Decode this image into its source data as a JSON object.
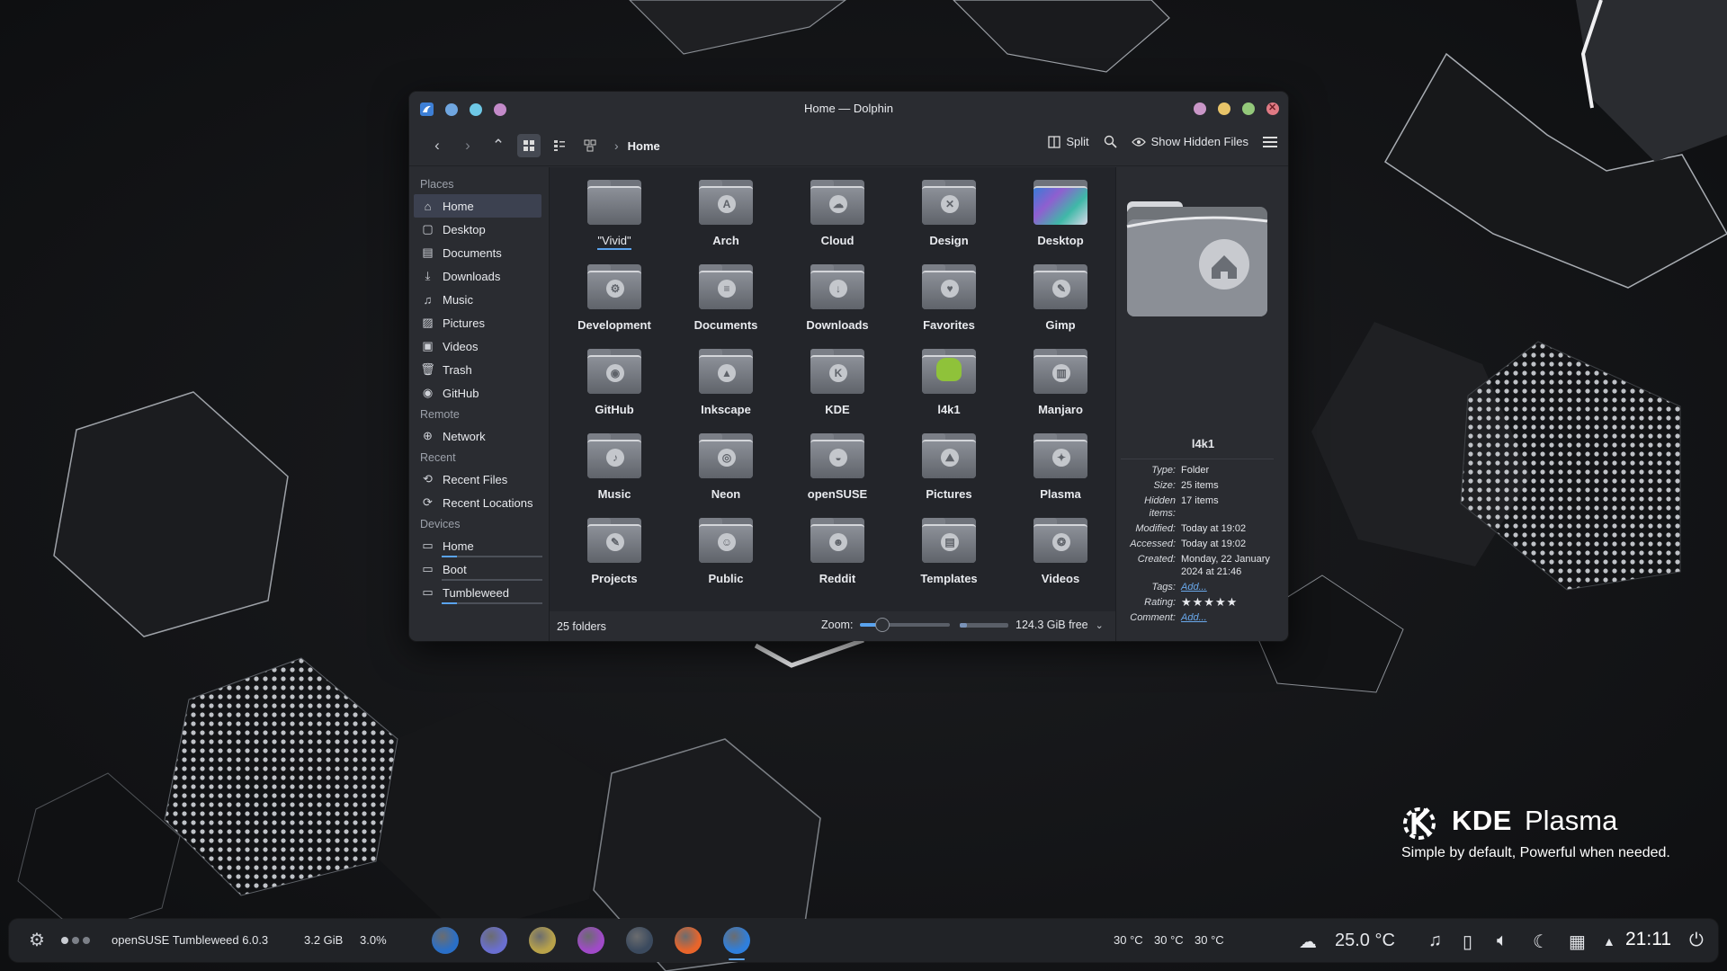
{
  "desktop": {
    "brand_kde": "KDE",
    "brand_plasma": "Plasma",
    "brand_tagline": "Simple by default, Powerful when  needed."
  },
  "window": {
    "title": "Home — Dolphin",
    "breadcrumb": "Home",
    "toolbar": {
      "split_label": "Split",
      "hidden_files_label": "Show Hidden Files"
    }
  },
  "sidebar": {
    "places_label": "Places",
    "places": [
      {
        "label": "Home",
        "icon": "home-icon",
        "selected": true
      },
      {
        "label": "Desktop",
        "icon": "desktop-icon"
      },
      {
        "label": "Documents",
        "icon": "documents-icon"
      },
      {
        "label": "Downloads",
        "icon": "downloads-icon"
      },
      {
        "label": "Music",
        "icon": "music-icon"
      },
      {
        "label": "Pictures",
        "icon": "pictures-icon"
      },
      {
        "label": "Videos",
        "icon": "videos-icon"
      },
      {
        "label": "Trash",
        "icon": "trash-icon"
      },
      {
        "label": "GitHub",
        "icon": "github-icon"
      }
    ],
    "remote_label": "Remote",
    "remote": [
      {
        "label": "Network",
        "icon": "network-icon"
      }
    ],
    "recent_label": "Recent",
    "recent": [
      {
        "label": "Recent Files",
        "icon": "recent-files-icon"
      },
      {
        "label": "Recent Locations",
        "icon": "recent-locations-icon"
      }
    ],
    "devices_label": "Devices",
    "devices": [
      {
        "label": "Home",
        "icon": "drive-icon",
        "usage": 0.15
      },
      {
        "label": "Boot",
        "icon": "drive-icon",
        "usage": 0.0
      },
      {
        "label": "Tumbleweed",
        "icon": "drive-icon",
        "usage": 0.15
      }
    ]
  },
  "folders": [
    {
      "name": "\"Vivid\"",
      "emblem": ""
    },
    {
      "name": "Arch",
      "emblem": "A"
    },
    {
      "name": "Cloud",
      "emblem": "☁"
    },
    {
      "name": "Design",
      "emblem": "✕"
    },
    {
      "name": "Desktop",
      "emblem": ""
    },
    {
      "name": "Development",
      "emblem": "⚙"
    },
    {
      "name": "Documents",
      "emblem": "≡"
    },
    {
      "name": "Downloads",
      "emblem": "↓"
    },
    {
      "name": "Favorites",
      "emblem": "♥"
    },
    {
      "name": "Gimp",
      "emblem": "✎"
    },
    {
      "name": "GitHub",
      "emblem": "◉"
    },
    {
      "name": "Inkscape",
      "emblem": "▲"
    },
    {
      "name": "KDE",
      "emblem": "K"
    },
    {
      "name": "l4k1",
      "emblem": ""
    },
    {
      "name": "Manjaro",
      "emblem": "▥"
    },
    {
      "name": "Music",
      "emblem": "♪"
    },
    {
      "name": "Neon",
      "emblem": "◎"
    },
    {
      "name": "openSUSE",
      "emblem": "◒"
    },
    {
      "name": "Pictures",
      "emblem": "⛰"
    },
    {
      "name": "Plasma",
      "emblem": "✦"
    },
    {
      "name": "Projects",
      "emblem": "✎"
    },
    {
      "name": "Public",
      "emblem": "☺"
    },
    {
      "name": "Reddit",
      "emblem": "☻"
    },
    {
      "name": "Templates",
      "emblem": "▤"
    },
    {
      "name": "Videos",
      "emblem": "❂"
    }
  ],
  "status": {
    "count": "25 folders",
    "zoom_label": "Zoom:",
    "zoom_level": 0.25,
    "free_space": "124.3 GiB free",
    "space_used": 0.15
  },
  "info_panel": {
    "name": "l4k1",
    "meta": [
      {
        "key": "Type:",
        "value": "Folder"
      },
      {
        "key": "Size:",
        "value": "25 items"
      },
      {
        "key": "Hidden items:",
        "value": "17 items"
      },
      {
        "key": "Modified:",
        "value": "Today at 19:02"
      },
      {
        "key": "Accessed:",
        "value": "Today at 19:02"
      },
      {
        "key": "Created:",
        "value": "Monday, 22 January 2024 at 21:46"
      }
    ],
    "tags_label": "Tags:",
    "tags_value": "Add...",
    "rating_label": "Rating:",
    "rating_value": "★★★★★",
    "comment_label": "Comment:",
    "comment_value": "Add..."
  },
  "taskbar": {
    "distro": "openSUSE Tumbleweed 6.0.3",
    "memory": "3.2 GiB",
    "cpu": "3.0%",
    "temps": [
      "30 °C",
      "30 °C",
      "30 °C"
    ],
    "weather": "25.0 °C",
    "clock": "21:11",
    "apps": [
      {
        "name": "app-1",
        "color": "#2a6fc7"
      },
      {
        "name": "app-2",
        "color": "#6a6fd0"
      },
      {
        "name": "app-3",
        "color": "#b8a24a"
      },
      {
        "name": "app-4",
        "color": "#a04ac8"
      },
      {
        "name": "app-5",
        "color": "#3b4a5e"
      },
      {
        "name": "firefox",
        "color": "#e8652b"
      },
      {
        "name": "dolphin",
        "color": "#2f7fdc"
      }
    ]
  },
  "colors": {
    "accent": "#5aa3ee",
    "window_bg": "#2a2c31",
    "view_bg": "#23252a"
  }
}
